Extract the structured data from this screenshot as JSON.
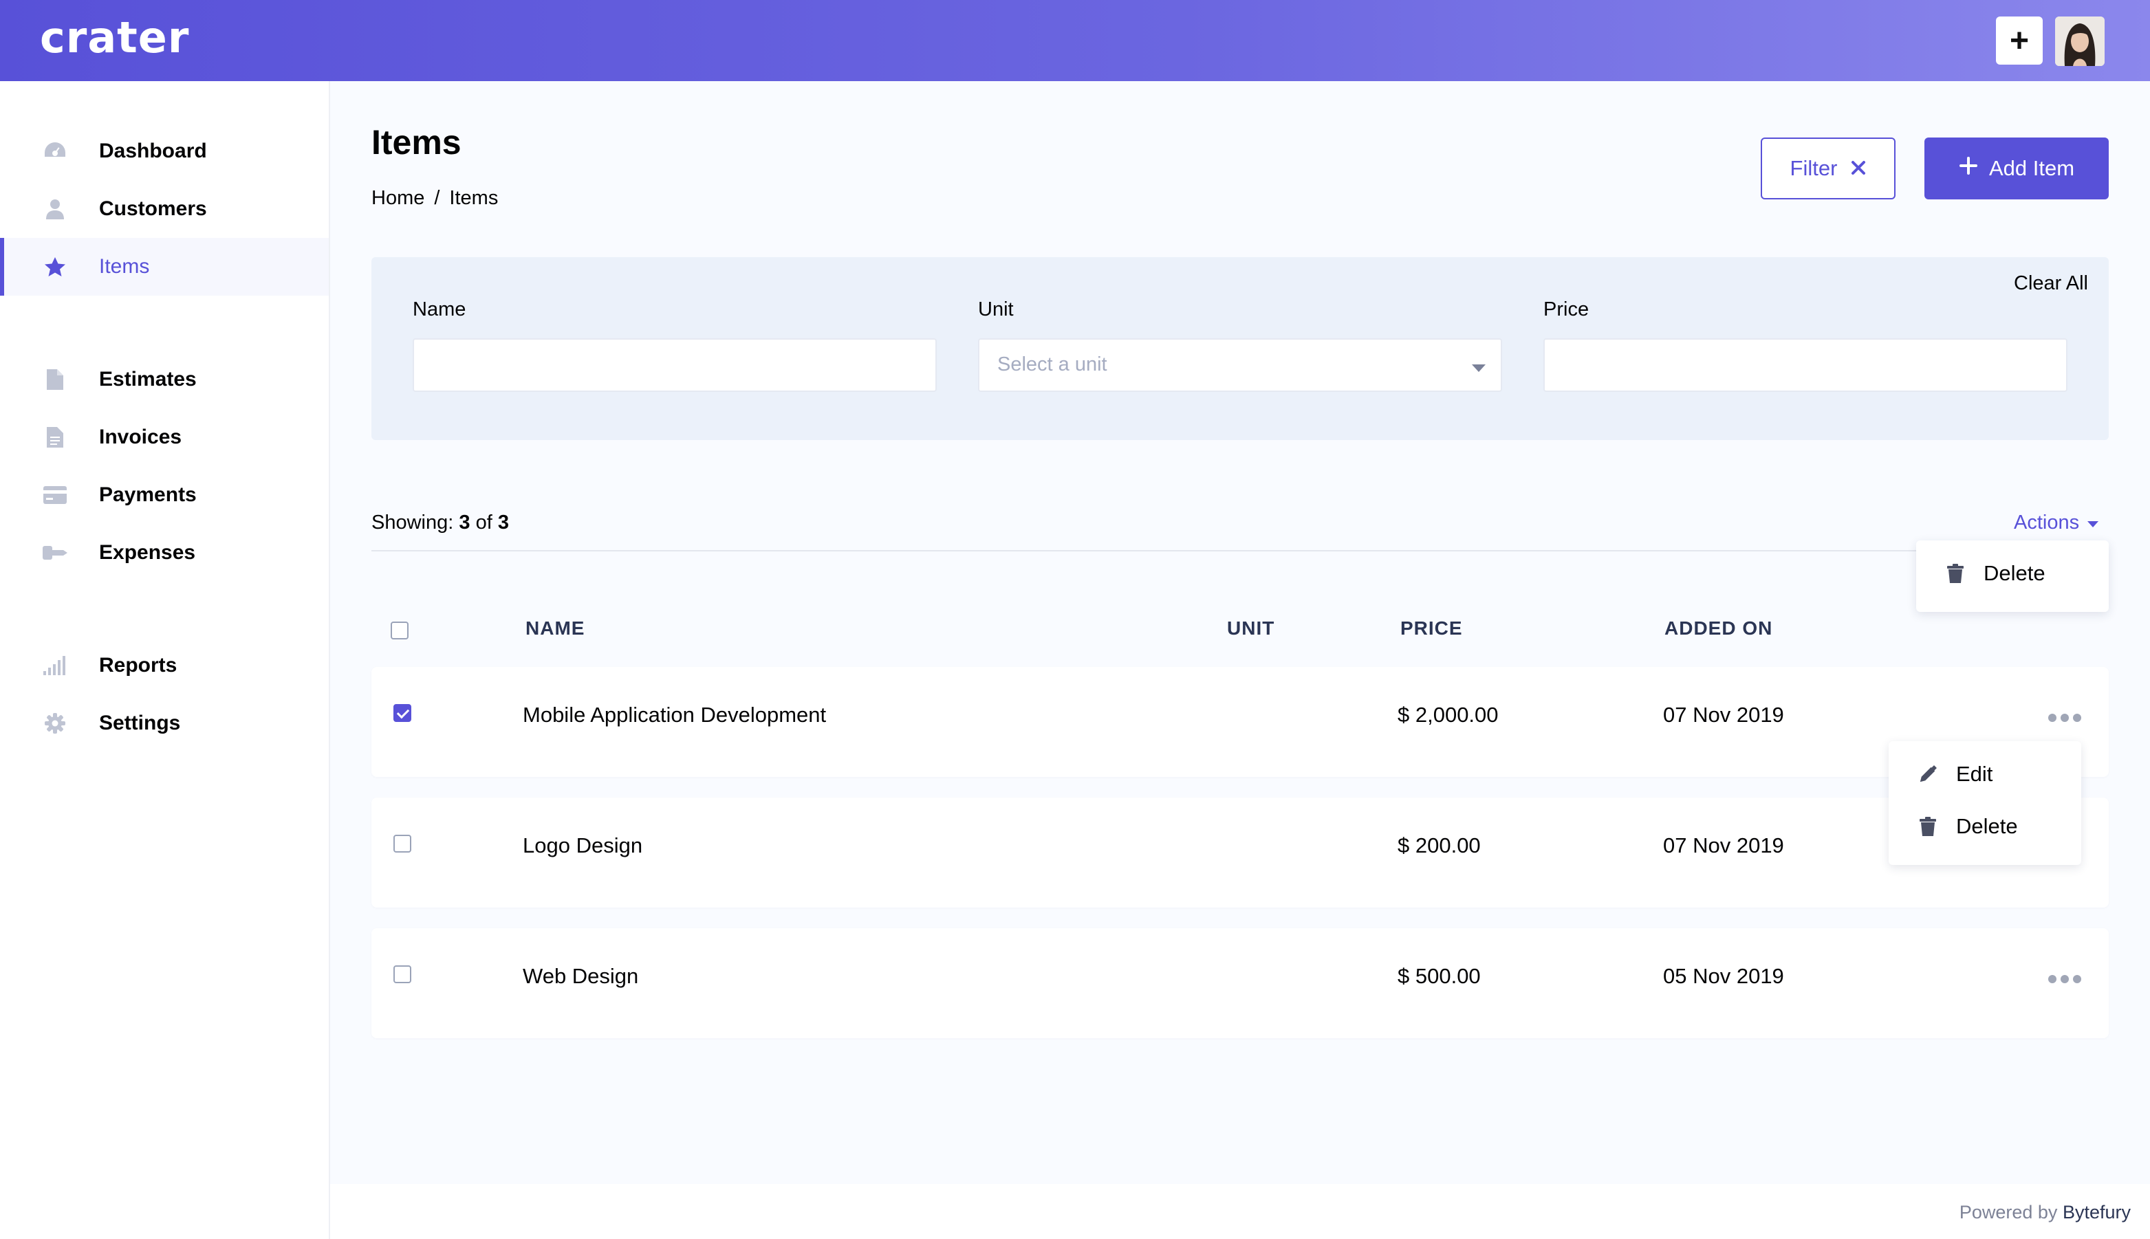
{
  "app": {
    "logo": "crater",
    "brand_color": "#5851d8"
  },
  "header": {
    "quick_add_label": "+"
  },
  "sidebar": {
    "items": [
      {
        "label": "Dashboard",
        "icon": "dashboard-icon"
      },
      {
        "label": "Customers",
        "icon": "user-icon"
      },
      {
        "label": "Items",
        "icon": "star-icon",
        "active": true
      },
      {
        "label": "Estimates",
        "icon": "document-icon"
      },
      {
        "label": "Invoices",
        "icon": "file-text-icon"
      },
      {
        "label": "Payments",
        "icon": "credit-card-icon"
      },
      {
        "label": "Expenses",
        "icon": "key-icon"
      },
      {
        "label": "Reports",
        "icon": "signal-icon"
      },
      {
        "label": "Settings",
        "icon": "gear-icon"
      }
    ]
  },
  "page": {
    "title": "Items",
    "breadcrumb": {
      "home": "Home",
      "separator": "/",
      "current": "Items"
    },
    "filter_button": "Filter",
    "add_button": "Add Item"
  },
  "filters": {
    "clear_all": "Clear All",
    "name": {
      "label": "Name",
      "value": ""
    },
    "unit": {
      "label": "Unit",
      "placeholder": "Select a unit"
    },
    "price": {
      "label": "Price",
      "value": ""
    }
  },
  "list": {
    "showing_prefix": "Showing:",
    "showing_count": "3",
    "showing_of": "of",
    "showing_total": "3",
    "actions_label": "Actions",
    "bulk_menu": {
      "delete": "Delete"
    },
    "columns": {
      "name": "NAME",
      "unit": "UNIT",
      "price": "PRICE",
      "added_on": "ADDED ON"
    },
    "rows": [
      {
        "name": "Mobile Application Development",
        "unit": "",
        "price": "$ 2,000.00",
        "added_on": "07 Nov 2019",
        "checked": true
      },
      {
        "name": "Logo Design",
        "unit": "",
        "price": "$ 200.00",
        "added_on": "07 Nov 2019",
        "checked": false
      },
      {
        "name": "Web Design",
        "unit": "",
        "price": "$ 500.00",
        "added_on": "05 Nov 2019",
        "checked": false
      }
    ],
    "row_menu": {
      "edit": "Edit",
      "delete": "Delete"
    }
  },
  "footer": {
    "powered_by": "Powered by",
    "brand": "Bytefury"
  }
}
